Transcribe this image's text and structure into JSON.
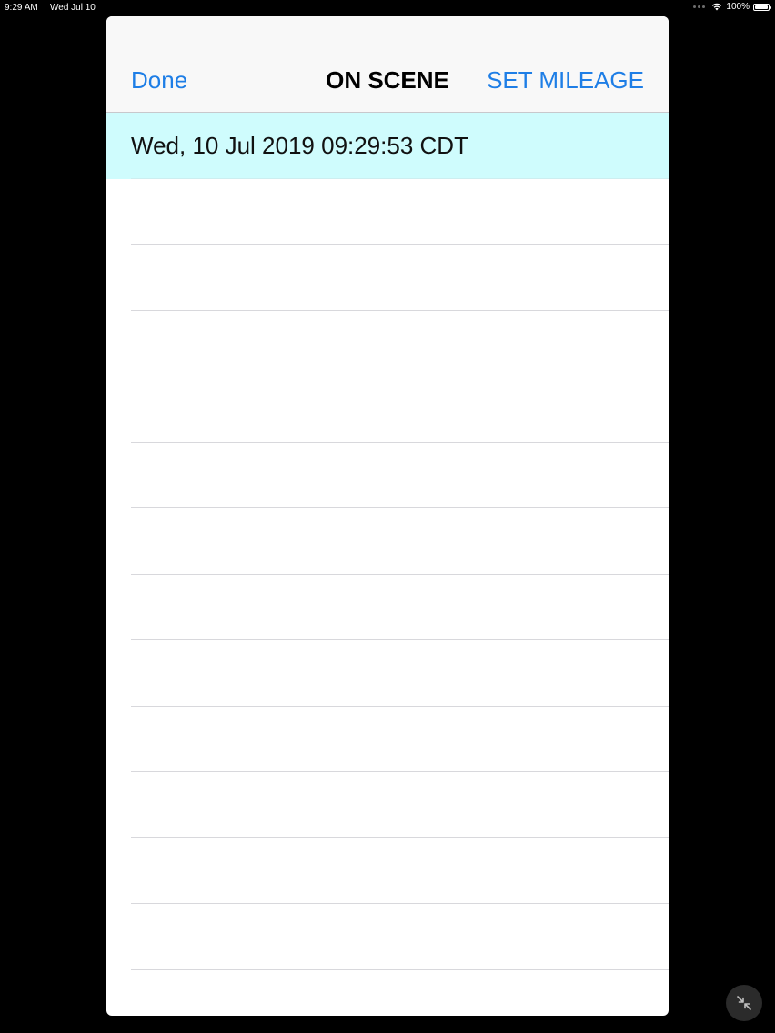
{
  "status_bar": {
    "time": "9:29 AM",
    "date": "Wed Jul 10",
    "battery": "100%"
  },
  "nav": {
    "done_label": "Done",
    "title": "ON SCENE",
    "set_mileage_label": "SET MILEAGE"
  },
  "table": {
    "rows": [
      {
        "text": "Wed, 10 Jul 2019 09:29:53 CDT",
        "selected": true
      },
      {
        "text": ""
      },
      {
        "text": ""
      },
      {
        "text": ""
      },
      {
        "text": ""
      },
      {
        "text": ""
      },
      {
        "text": ""
      },
      {
        "text": ""
      },
      {
        "text": ""
      },
      {
        "text": ""
      },
      {
        "text": ""
      },
      {
        "text": ""
      },
      {
        "text": ""
      },
      {
        "text": ""
      }
    ]
  },
  "colors": {
    "accent": "#1e7ee6",
    "selected_row": "#cffcfd",
    "background": "#000000"
  },
  "icons": {
    "wifi": "wifi-icon",
    "battery": "battery-icon",
    "minimize": "arrows-collapse-icon"
  }
}
